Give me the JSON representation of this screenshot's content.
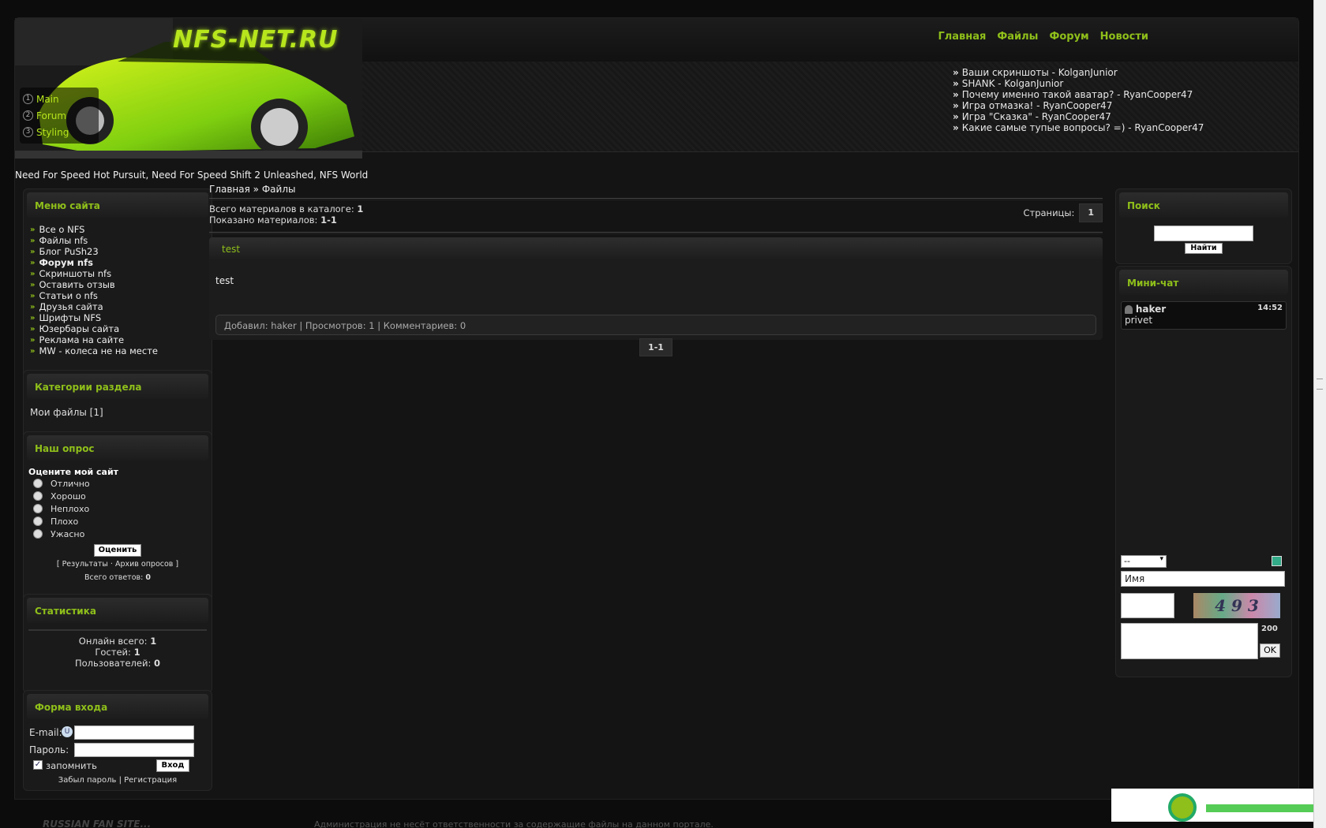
{
  "header": {
    "logo": "NFS-NET.RU",
    "banner_side_links": [
      {
        "num": "1",
        "label": "Main"
      },
      {
        "num": "2",
        "label": "Forum"
      },
      {
        "num": "3",
        "label": "Styling"
      }
    ],
    "nav": [
      "Главная",
      "Файлы",
      "Форум",
      "Новости"
    ],
    "recent_posts": [
      "Ваши скриншоты - KolganJunior",
      "SHANK - KolganJunior",
      "Почему именно такой аватар? - RyanCooper47",
      "Игра отмазка! - RyanCooper47",
      "Игра \"Сказка\" - RyanCooper47",
      "Какие самые тупые вопросы? =) - RyanCooper47"
    ],
    "games_line": "Need For Speed Hot Pursuit, Need For Speed Shift 2 Unleashed, NFS World"
  },
  "site_menu": {
    "title": "Меню сайта",
    "items": [
      "Все о NFS",
      "Файлы nfs",
      "Блог PuSh23",
      "Форум nfs",
      "Скриншоты nfs",
      "Оставить отзыв",
      "Статьи о nfs",
      "Друзья сайта",
      "Шрифты NFS",
      "Юзербары сайта",
      "Реклама на сайте",
      "MW - колеса не на месте"
    ]
  },
  "categories": {
    "title": "Категории раздела",
    "item": "Мои файлы [1]"
  },
  "poll": {
    "title": "Наш опрос",
    "question": "Оцените мой сайт",
    "options": [
      "Отлично",
      "Хорошо",
      "Неплохо",
      "Плохо",
      "Ужасно"
    ],
    "vote_button": "Оценить",
    "results_link": "Результаты",
    "archive_link": "Архив опросов",
    "total_label": "Всего ответов:",
    "total_value": "0"
  },
  "stats": {
    "title": "Статистика",
    "online_label": "Онлайн всего:",
    "online_value": "1",
    "guests_label": "Гостей:",
    "guests_value": "1",
    "users_label": "Пользователей:",
    "users_value": "0"
  },
  "login": {
    "title": "Форма входа",
    "email_label": "E-mail:",
    "password_label": "Пароль:",
    "remember_label": "запомнить",
    "submit": "Вход",
    "forgot_link": "Забыл пароль",
    "register_link": "Регистрация"
  },
  "main": {
    "breadcrumb_home": "Главная",
    "breadcrumb_sep": "»",
    "breadcrumb_current": "Файлы",
    "total_label": "Всего материалов в каталоге:",
    "total_value": "1",
    "shown_label": "Показано материалов:",
    "shown_value": "1-1",
    "pages_label": "Страницы:",
    "pages_value": "1",
    "entry": {
      "title": "test",
      "body": "test",
      "added_label": "Добавил:",
      "author": "haker",
      "views_label": "Просмотров:",
      "views": "1",
      "comments_label": "Комментариев:",
      "comments": "0"
    },
    "pager_range": "1-1"
  },
  "search": {
    "title": "Поиск",
    "button": "Найти"
  },
  "chat": {
    "title": "Мини-чат",
    "messages": [
      {
        "user": "haker",
        "time": "14:52",
        "text": "privet"
      }
    ],
    "select_value": "--",
    "name_placeholder": "Имя",
    "captcha_text": "4 9 3",
    "char_limit": "200",
    "ok_button": "OK"
  },
  "footer": {
    "tagline": "RUSSIAN FAN SITE...",
    "disclaimer": "Администрация не несёт ответственности за содержащие файлы на данном портале."
  },
  "colors": {
    "accent": "#8fbf1a",
    "background": "#141414"
  }
}
